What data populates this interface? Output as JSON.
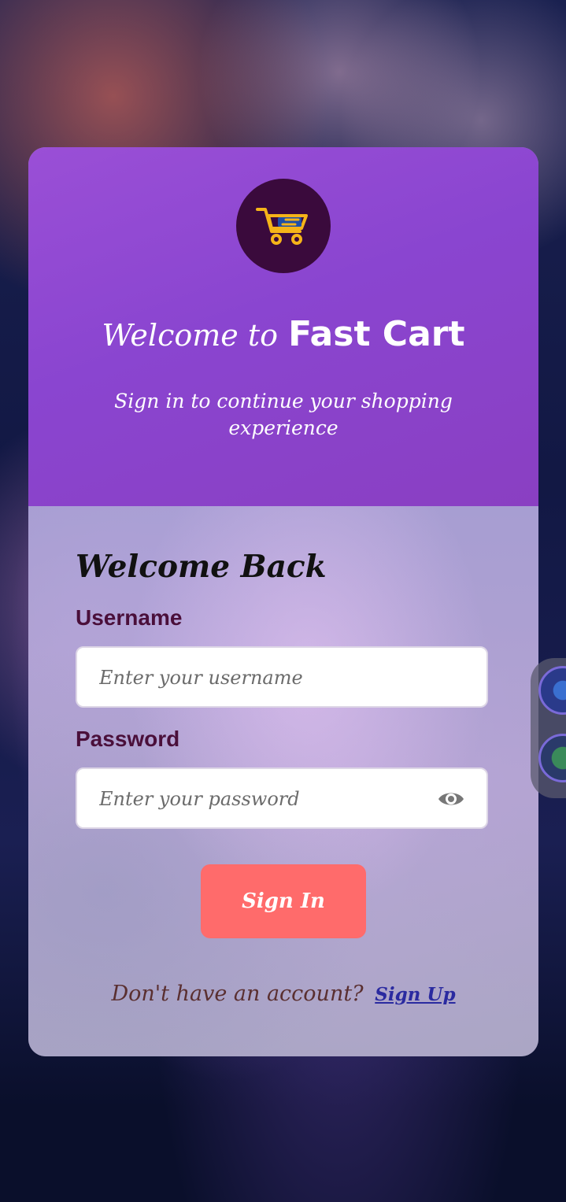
{
  "header": {
    "welcome_prefix": "Welcome to",
    "brand_name": "Fast Cart",
    "subtitle": "Sign in to continue your shopping experience",
    "logo_icon": "shopping-cart-icon"
  },
  "form": {
    "title": "Welcome Back",
    "username_label": "Username",
    "username_placeholder": "Enter your username",
    "password_label": "Password",
    "password_placeholder": "Enter your password",
    "show_password_icon": "eye-icon",
    "signin_label": "Sign In"
  },
  "footer": {
    "prompt": "Don't have an account?",
    "signup_label": "Sign Up"
  },
  "colors": {
    "header_purple": "#8a45d0",
    "button_coral": "#ff6b6b",
    "logo_bg": "#3a0a3c",
    "label_color": "#4a0f3a"
  }
}
